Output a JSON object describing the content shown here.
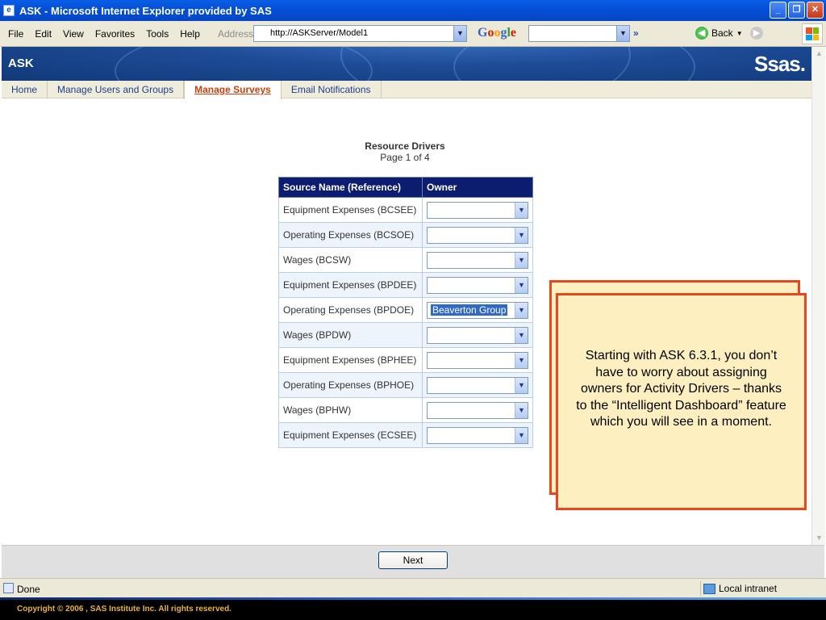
{
  "window": {
    "title": "ASK - Microsoft Internet Explorer provided by SAS",
    "minimize": "_",
    "restore": "❐",
    "close": "✕"
  },
  "menubar": {
    "items": [
      "File",
      "Edit",
      "View",
      "Favorites",
      "Tools",
      "Help"
    ],
    "address_label": "Address",
    "address_url": "http://ASKServer/Model1",
    "google_label": "Google",
    "back_label": "Back",
    "more_chevron": "»"
  },
  "banner": {
    "app_name": "ASK",
    "logo_text": "Ssas."
  },
  "nav": {
    "tabs": [
      "Home",
      "Manage Users and Groups",
      "Manage Surveys",
      "Email Notifications"
    ],
    "active_tab": "Manage Surveys"
  },
  "page": {
    "title": "Resource Drivers",
    "subtitle": "Page 1 of 4"
  },
  "table": {
    "headers": [
      "Source Name (Reference)",
      "Owner"
    ],
    "rows": [
      {
        "source": "Equipment Expenses (BCSEE)",
        "owner": ""
      },
      {
        "source": "Operating Expenses (BCSOE)",
        "owner": ""
      },
      {
        "source": "Wages (BCSW)",
        "owner": ""
      },
      {
        "source": "Equipment Expenses (BPDEE)",
        "owner": ""
      },
      {
        "source": "Operating Expenses (BPDOE)",
        "owner": "Beaverton Group"
      },
      {
        "source": "Wages (BPDW)",
        "owner": ""
      },
      {
        "source": "Equipment Expenses (BPHEE)",
        "owner": ""
      },
      {
        "source": "Operating Expenses (BPHOE)",
        "owner": ""
      },
      {
        "source": "Wages (BPHW)",
        "owner": ""
      },
      {
        "source": "Equipment Expenses (ECSEE)",
        "owner": ""
      }
    ]
  },
  "buttons": {
    "next": "Next"
  },
  "callout": {
    "text": "Starting with ASK 6.3.1, you don’t have to worry about assigning owners for Activity Drivers – thanks to the “Intelligent Dashboard” feature which you will see in a moment."
  },
  "status": {
    "text": "Done",
    "zone": "Local intranet"
  },
  "footer": {
    "copyright": "Copyright © 2006 , SAS Institute Inc. All rights reserved."
  },
  "colors": {
    "accent_orange": "#e8461e",
    "header_navy": "#0c1d70",
    "callout_fill": "#fdefbf"
  }
}
